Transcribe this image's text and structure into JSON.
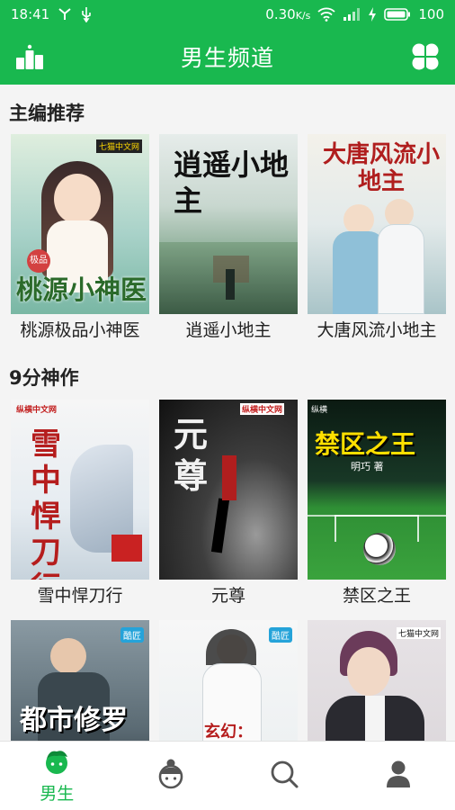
{
  "status_bar": {
    "time": "18:41",
    "network_speed": "0.30",
    "network_unit": "K/s",
    "battery": "100"
  },
  "app_bar": {
    "title": "男生频道",
    "left_icon": "ranking-icon",
    "right_icon": "clover-grid-icon"
  },
  "sections": [
    {
      "title": "主编推荐",
      "books": [
        {
          "name": "桃源极品小神医",
          "cover_title": "桃源小神医",
          "cover_badge": "极品",
          "publisher": "七猫中文网"
        },
        {
          "name": "逍遥小地主",
          "cover_title": "逍遥小地主"
        },
        {
          "name": "大唐风流小地主",
          "cover_title": "大唐风流小地主"
        }
      ]
    },
    {
      "title": "9分神作",
      "books": [
        {
          "name": "雪中悍刀行",
          "cover_title": "雪中悍刀行",
          "publisher": "纵横中文网"
        },
        {
          "name": "元尊",
          "cover_title": "元尊",
          "publisher": "纵横中文网"
        },
        {
          "name": "禁区之王",
          "cover_title": "禁区之王",
          "publisher": "纵横",
          "author": "明巧 著"
        }
      ]
    },
    {
      "title": "",
      "books": [
        {
          "cover_title": "都市修罗",
          "publisher": "酷匠"
        },
        {
          "cover_title": "玄幻：",
          "publisher": "酷匠"
        },
        {
          "cover_title": "",
          "publisher": "七猫中文网"
        }
      ]
    }
  ],
  "tabs": [
    {
      "label": "男生",
      "icon": "boy-face-icon",
      "active": true
    },
    {
      "label": "",
      "icon": "girl-face-icon",
      "active": false
    },
    {
      "label": "",
      "icon": "search-icon",
      "active": false
    },
    {
      "label": "",
      "icon": "user-icon",
      "active": false
    }
  ],
  "colors": {
    "brand_green": "#19b84f",
    "background": "#f4f4f4",
    "inactive_icon": "#555555"
  }
}
